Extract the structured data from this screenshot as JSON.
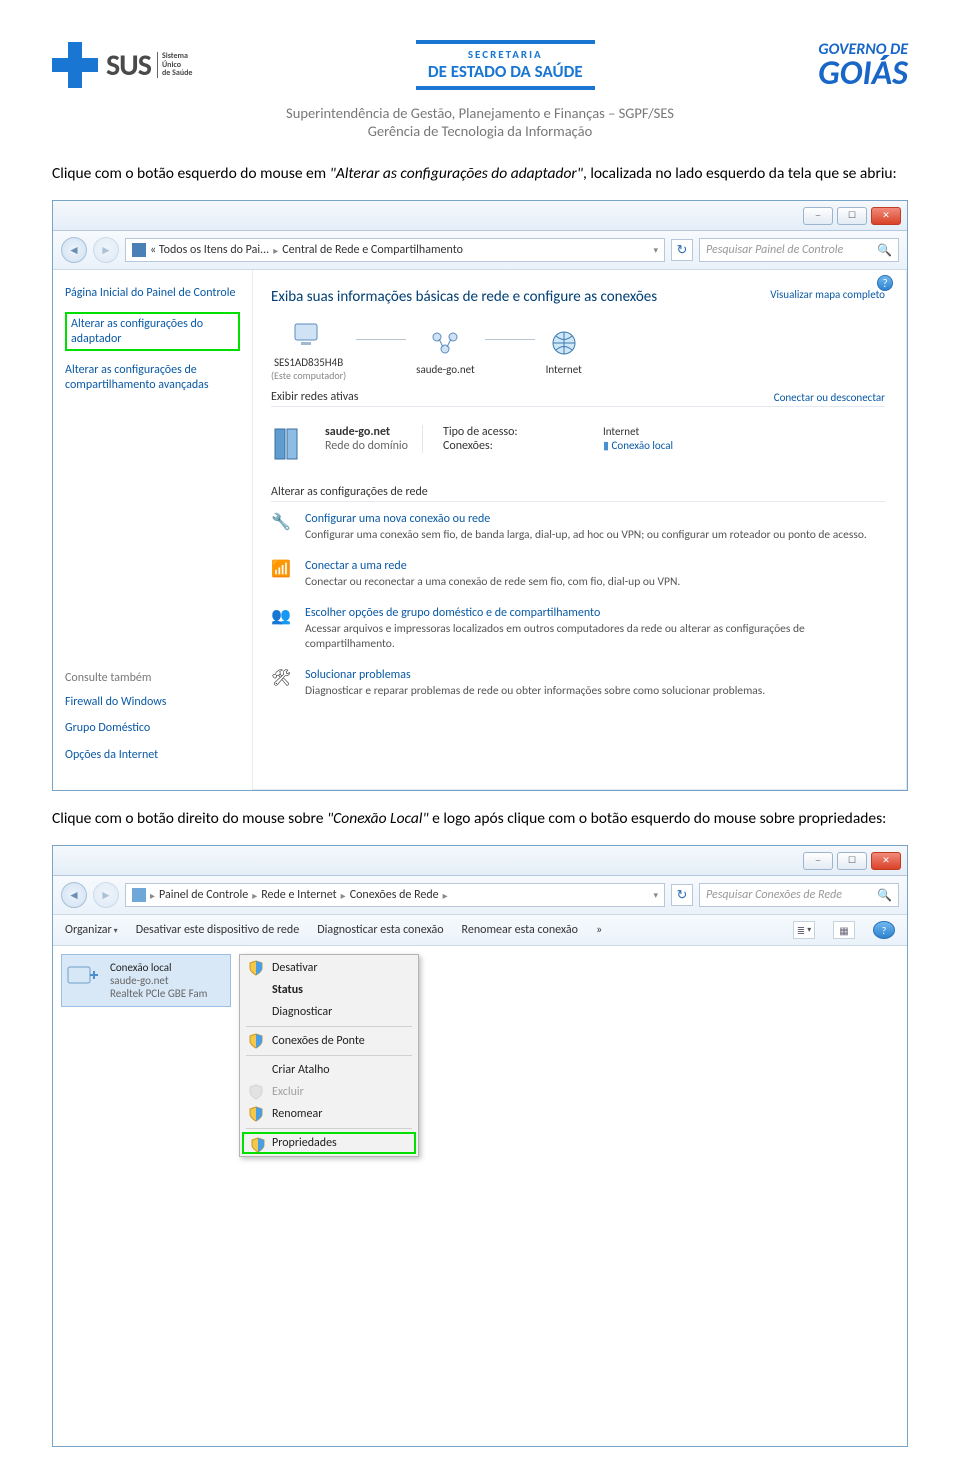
{
  "header": {
    "sus_brand": "SUS",
    "sus_sub": "Sistema\nÚnico\nde Saúde",
    "sec_line1": "SECRETARIA",
    "sec_line2": "DE ESTADO DA SAÚDE",
    "gov_line1": "GOVERNO DE",
    "gov_line2": "GOIÁS",
    "sub1": "Superintendência de Gestão, Planejamento e Finanças – SGPF/SES",
    "sub2": "Gerência de Tecnologia da Informação"
  },
  "instruction1_a": "Clique com o botão esquerdo do mouse em ",
  "instruction1_b": "\"Alterar as configurações do adaptador\"",
  "instruction1_c": ", localizada no lado esquerdo da tela que se abriu:",
  "instruction2_a": "Clique com o botão direito do mouse sobre ",
  "instruction2_b": "\"Conexão Local\"",
  "instruction2_c": " e logo após clique com o botão esquerdo do mouse sobre propriedades:",
  "win1": {
    "breadcrumb_pre": "«  Todos os Itens do Pai...",
    "breadcrumb_cur": "Central de Rede e Compartilhamento",
    "search_placeholder": "Pesquisar Painel de Controle",
    "side": {
      "home": "Página Inicial do Painel de Controle",
      "adapter": "Alterar as configurações do adaptador",
      "sharing": "Alterar as configurações de compartilhamento avançadas",
      "see_also": "Consulte também",
      "firewall": "Firewall do Windows",
      "homegroup": "Grupo Doméstico",
      "inetopt": "Opções da Internet"
    },
    "main": {
      "title": "Exiba suas informações básicas de rede e configure as conexões",
      "view_map": "Visualizar mapa completo",
      "pc_name": "SES1AD835H4B",
      "pc_sub": "(Este computador)",
      "domain": "saude-go.net",
      "inet": "Internet",
      "active": "Exibir redes ativas",
      "conn_disc": "Conectar ou desconectar",
      "dom_name": "saude-go.net",
      "dom_sub": "Rede do domínio",
      "access_lbl": "Tipo de acesso:",
      "access_val": "Internet",
      "conn_lbl": "Conexões:",
      "conn_val": "Conexão local",
      "section": "Alterar as configurações de rede",
      "o1_t": "Configurar uma nova conexão ou rede",
      "o1_d": "Configurar uma conexão sem fio, de banda larga, dial-up, ad hoc ou VPN; ou configurar um roteador ou ponto de acesso.",
      "o2_t": "Conectar a uma rede",
      "o2_d": "Conectar ou reconectar a uma conexão de rede sem fio, com fio, dial-up ou VPN.",
      "o3_t": "Escolher opções de grupo doméstico e de compartilhamento",
      "o3_d": "Acessar arquivos e impressoras localizados em outros computadores da rede ou alterar as configurações de compartilhamento.",
      "o4_t": "Solucionar problemas",
      "o4_d": "Diagnosticar e reparar problemas de rede ou obter informações sobre como solucionar problemas."
    }
  },
  "win2": {
    "crumb1": "Painel de Controle",
    "crumb2": "Rede e Internet",
    "crumb3": "Conexões de Rede",
    "search_placeholder": "Pesquisar Conexões de Rede",
    "tb": {
      "org": "Organizar",
      "disable": "Desativar este dispositivo de rede",
      "diag": "Diagnosticar esta conexão",
      "rename": "Renomear esta conexão",
      "more": "»"
    },
    "conn": {
      "name": "Conexão local",
      "net": "saude-go.net",
      "dev": "Realtek PCIe GBE Fam"
    },
    "menu": {
      "disable": "Desativar",
      "status": "Status",
      "diag": "Diagnosticar",
      "bridge": "Conexões de Ponte",
      "shortcut": "Criar Atalho",
      "delete": "Excluir",
      "rename": "Renomear",
      "props": "Propriedades"
    }
  }
}
